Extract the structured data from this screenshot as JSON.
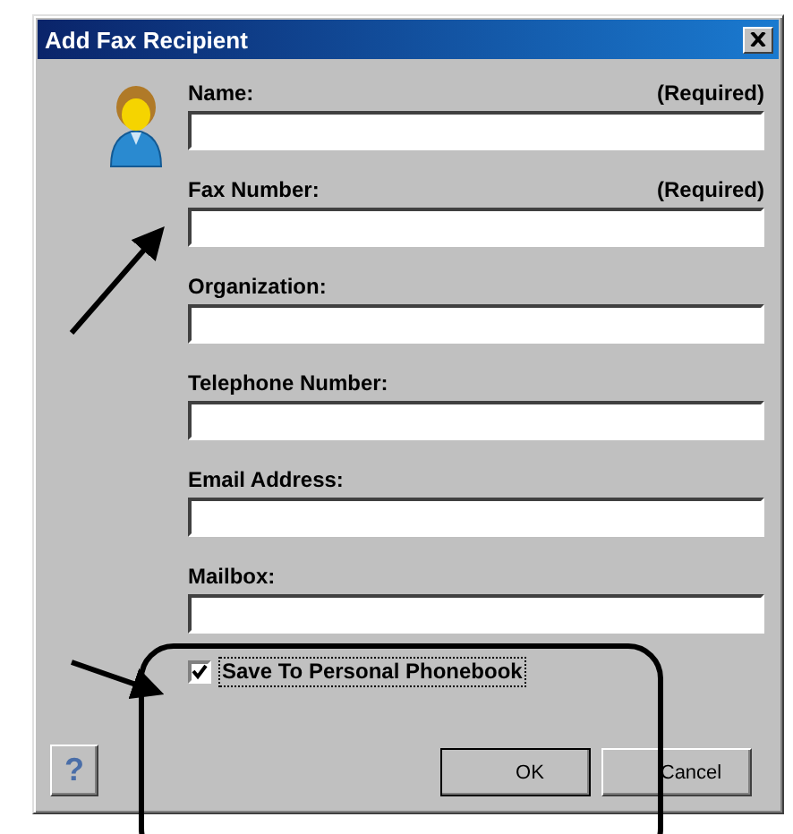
{
  "window": {
    "title": "Add Fax Recipient"
  },
  "fields": [
    {
      "label": "Name:",
      "note": "(Required)"
    },
    {
      "label": "Fax Number:",
      "note": "(Required)"
    },
    {
      "label": "Organization:"
    },
    {
      "label": "Telephone Number:"
    },
    {
      "label": "Email Address:"
    },
    {
      "label": "Mailbox:"
    }
  ],
  "save_option": {
    "label": "Save To Personal Phonebook",
    "checked": true
  },
  "help_button": {
    "label": "?"
  },
  "buttons": [
    {
      "label": "OK"
    },
    {
      "label": "Cancel"
    }
  ]
}
